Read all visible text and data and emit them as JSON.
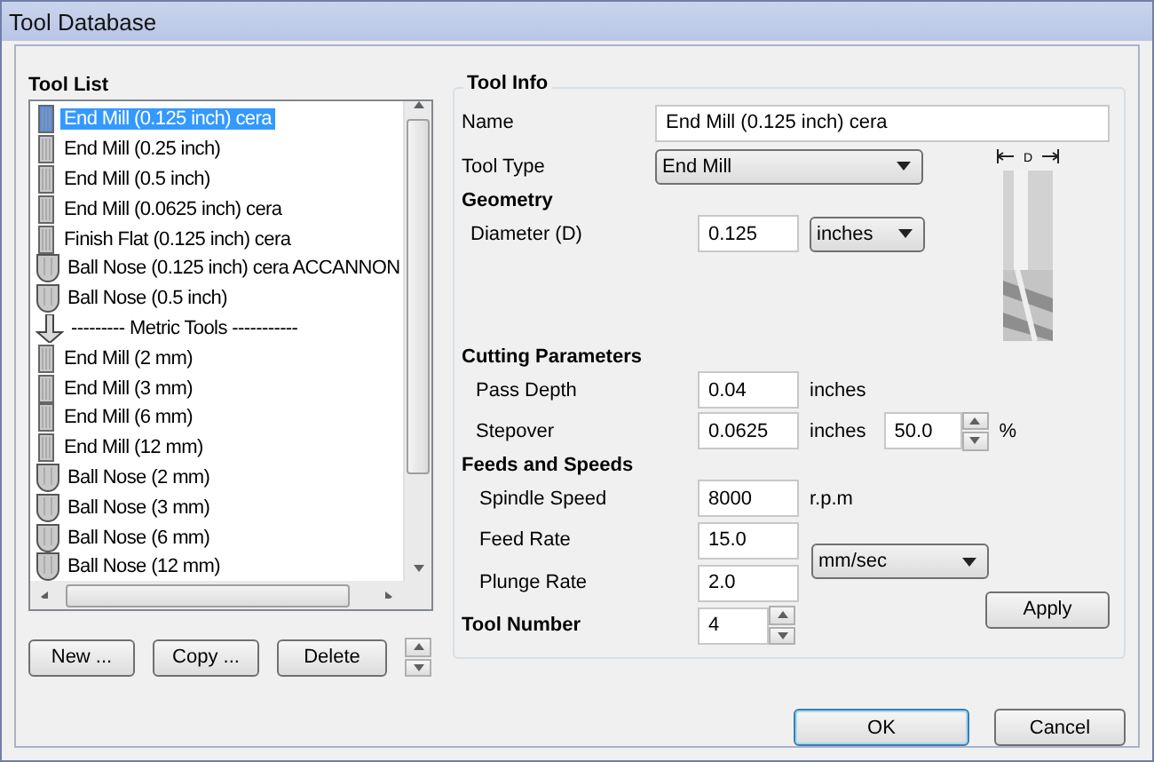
{
  "window": {
    "title": "Tool Database"
  },
  "tool_list": {
    "label": "Tool List",
    "items": [
      {
        "label": "End Mill (0.125 inch) cera",
        "kind": "end_mill",
        "selected": true
      },
      {
        "label": "End Mill (0.25 inch)",
        "kind": "end_mill",
        "selected": false
      },
      {
        "label": "End Mill (0.5 inch)",
        "kind": "end_mill",
        "selected": false
      },
      {
        "label": "End Mill (0.0625 inch) cera",
        "kind": "end_mill",
        "selected": false
      },
      {
        "label": "Finish Flat (0.125 inch) cera",
        "kind": "end_mill",
        "selected": false
      },
      {
        "label": "Ball Nose (0.125 inch) cera ACCANNON",
        "kind": "ball_nose",
        "selected": false
      },
      {
        "label": "Ball Nose (0.5 inch)",
        "kind": "ball_nose",
        "selected": false
      },
      {
        "label": "--------- Metric Tools -----------",
        "kind": "group",
        "selected": false
      },
      {
        "label": "End Mill (2 mm)",
        "kind": "end_mill",
        "selected": false
      },
      {
        "label": "End Mill (3 mm)",
        "kind": "end_mill",
        "selected": false
      },
      {
        "label": "End Mill (6 mm)",
        "kind": "end_mill",
        "selected": false
      },
      {
        "label": "End Mill (12 mm)",
        "kind": "end_mill",
        "selected": false
      },
      {
        "label": "Ball Nose (2 mm)",
        "kind": "ball_nose",
        "selected": false
      },
      {
        "label": "Ball Nose (3 mm)",
        "kind": "ball_nose",
        "selected": false
      },
      {
        "label": "Ball Nose (6 mm)",
        "kind": "ball_nose",
        "selected": false
      },
      {
        "label": "Ball Nose (12 mm)",
        "kind": "ball_nose",
        "selected": false
      }
    ],
    "buttons": [
      "New ...",
      "Copy ...",
      "Delete"
    ]
  },
  "tool_info": {
    "title": "Tool Info",
    "name_label": "Name",
    "name": "End Mill (0.125 inch) cera",
    "type_label": "Tool Type",
    "type": "End Mill",
    "geometry": {
      "title": "Geometry",
      "diameter_label": "Diameter (D)",
      "diameter": "0.125",
      "units": "inches",
      "drawing_label": "D"
    },
    "cutting": {
      "title": "Cutting Parameters",
      "pass_depth_label": "Pass Depth",
      "pass_depth": "0.04",
      "pass_depth_units": "inches",
      "stepover_label": "Stepover",
      "stepover": "0.0625",
      "stepover_units": "inches",
      "stepover_percent": "50.0",
      "percent_sign": "%"
    },
    "feeds": {
      "title": "Feeds and Speeds",
      "spindle_label": "Spindle Speed",
      "spindle": "8000",
      "spindle_units": "r.p.m",
      "feed_label": "Feed Rate",
      "feed": "15.0",
      "plunge_label": "Plunge Rate",
      "plunge": "2.0",
      "rate_units": "mm/sec"
    },
    "tool_number_label": "Tool Number",
    "tool_number": "4",
    "apply": "Apply"
  },
  "buttons": [
    "OK",
    "Cancel"
  ]
}
